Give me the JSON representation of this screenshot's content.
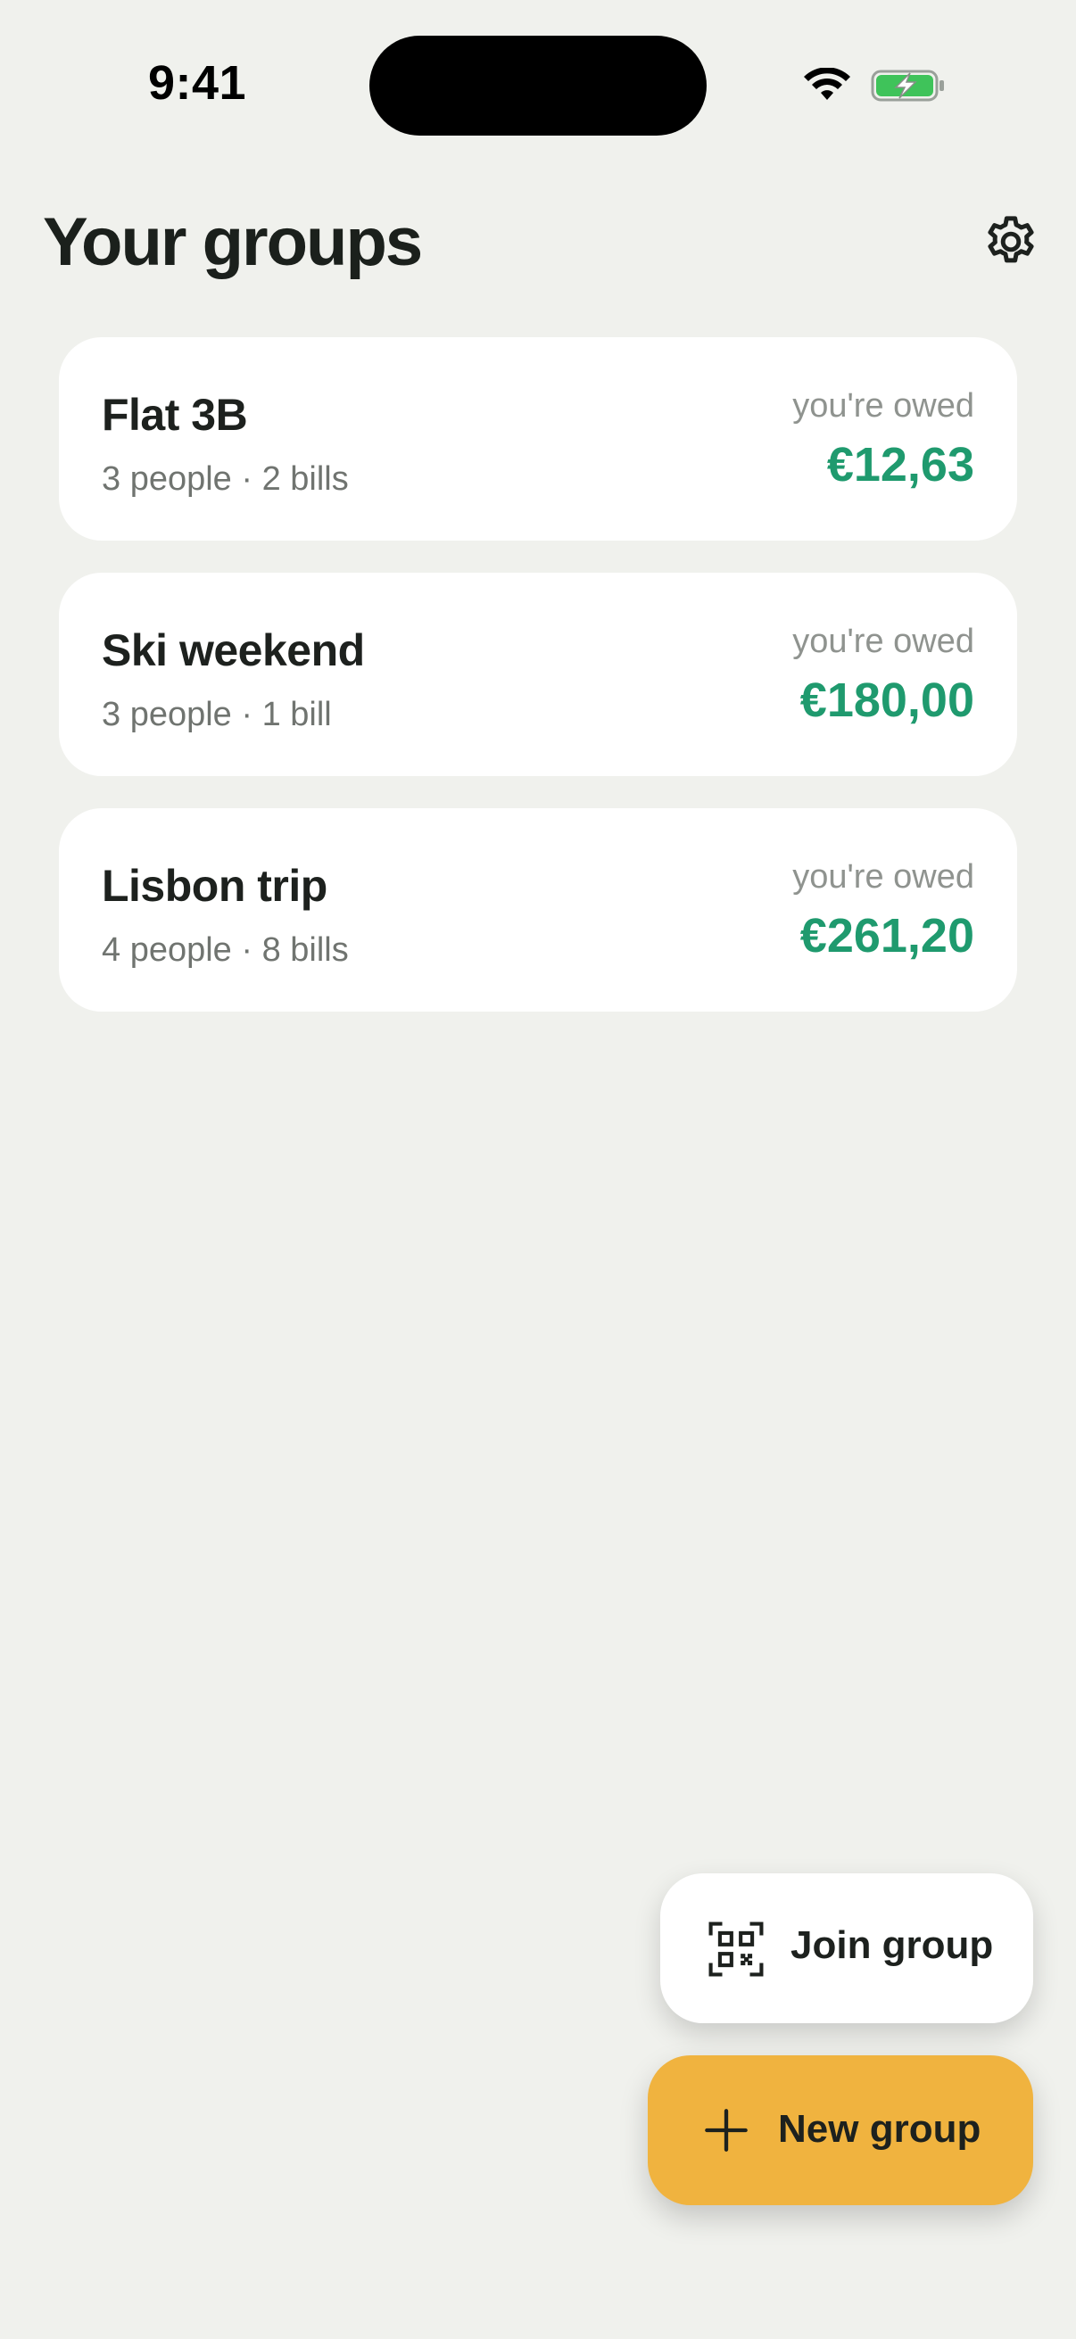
{
  "status_bar": {
    "time": "9:41",
    "wifi_icon": "wifi-icon",
    "battery_icon": "battery-charging-icon",
    "battery_color": "#3fc35a"
  },
  "header": {
    "title": "Your groups",
    "settings_icon": "gear-icon"
  },
  "groups": [
    {
      "name": "Flat 3B",
      "meta": "3 people · 2 bills",
      "owed_label": "you're owed",
      "amount": "€12,63"
    },
    {
      "name": "Ski weekend",
      "meta": "3 people · 1 bill",
      "owed_label": "you're owed",
      "amount": "€180,00"
    },
    {
      "name": "Lisbon trip",
      "meta": "4 people · 8 bills",
      "owed_label": "you're owed",
      "amount": "€261,20"
    }
  ],
  "actions": {
    "join": {
      "label": "Join group",
      "icon": "qr-code-icon"
    },
    "new": {
      "label": "New group",
      "icon": "plus-icon"
    }
  },
  "colors": {
    "background": "#f0f1ed",
    "card": "#ffffff",
    "positive_amount": "#1f9a6e",
    "accent": "#f0b33f"
  }
}
